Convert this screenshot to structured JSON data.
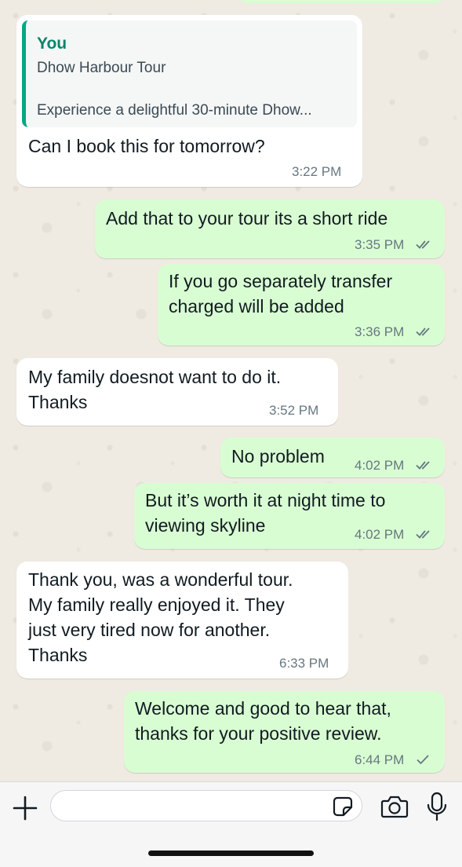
{
  "quoted": {
    "author": "You",
    "title": "Dhow Harbour Tour",
    "description": "Experience a delightful 30-minute Dhow..."
  },
  "messages": [
    {
      "text": "Can I book this for tomorrow?",
      "time": "3:22 PM",
      "direction": "incoming"
    },
    {
      "text": "Add that to your tour its a short ride",
      "time": "3:35 PM",
      "direction": "outgoing",
      "status": "read"
    },
    {
      "text": "If you go separately transfer\ncharged will be added",
      "time": "3:36 PM",
      "direction": "outgoing",
      "status": "read"
    },
    {
      "text": "My family doesnot want to do it.\nThanks",
      "time": "3:52 PM",
      "direction": "incoming"
    },
    {
      "text": "No problem",
      "time": "4:02 PM",
      "direction": "outgoing",
      "status": "read"
    },
    {
      "text": "But it’s worth it at night time to\nviewing skyline",
      "time": "4:02 PM",
      "direction": "outgoing",
      "status": "read"
    },
    {
      "text": "Thank you, was a wonderful tour.\nMy family really enjoyed it. They\njust very tired now for another.\nThanks",
      "time": "6:33 PM",
      "direction": "incoming"
    },
    {
      "text": "Welcome and good to hear that,\nthanks for your positive review.",
      "time": "6:44 PM",
      "direction": "outgoing",
      "status": "sent"
    }
  ],
  "input": {
    "placeholder": ""
  },
  "icons": {
    "attach": "plus-icon",
    "sticker": "sticker-icon",
    "camera": "camera-icon",
    "mic": "microphone-icon",
    "read_ticks": "double-check-icon",
    "sent_tick": "check-icon"
  },
  "colors": {
    "incoming_bubble": "#ffffff",
    "outgoing_bubble": "#d9fdd3",
    "quote_accent": "#06a884",
    "read_tick": "#667781",
    "background": "#efeae2"
  }
}
